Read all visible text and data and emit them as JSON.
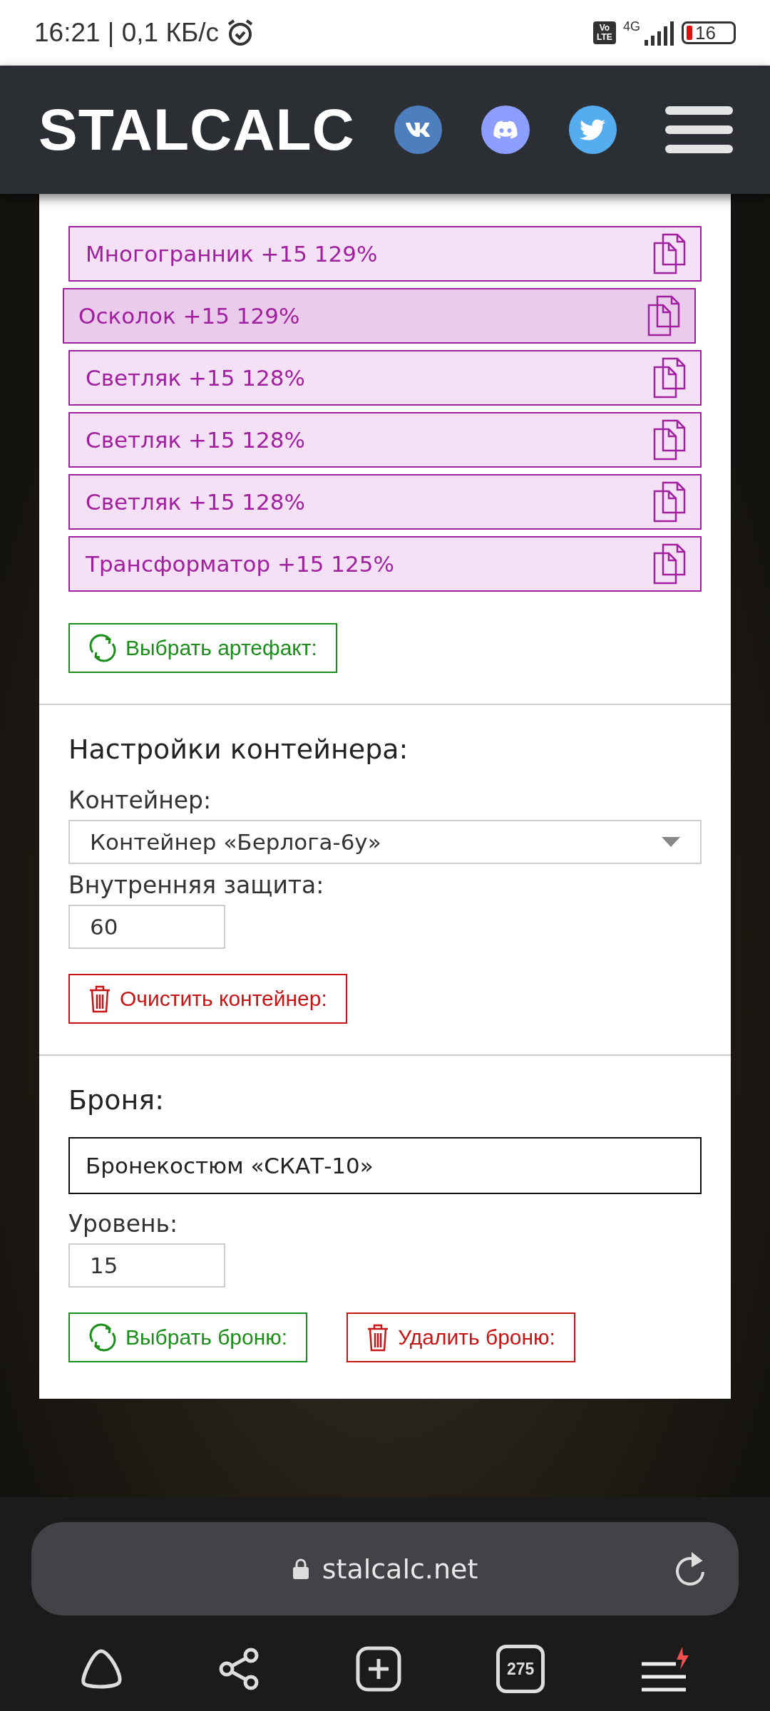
{
  "status_bar": {
    "time_speed": "16:21 | 0,1 КБ/с",
    "volte": "Vo LTE",
    "network": "4G",
    "battery": "16"
  },
  "header": {
    "logo": "STALCALC"
  },
  "artifacts": [
    {
      "label": "Многогранник +15 129%",
      "selected": false
    },
    {
      "label": "Осколок +15 129%",
      "selected": true
    },
    {
      "label": "Светляк +15 128%",
      "selected": false
    },
    {
      "label": "Светляк +15 128%",
      "selected": false
    },
    {
      "label": "Светляк +15 128%",
      "selected": false
    },
    {
      "label": "Трансформатор +15 125%",
      "selected": false
    }
  ],
  "select_artifact_button": "Выбрать артефакт:",
  "container_settings": {
    "title": "Настройки контейнера:",
    "container_label": "Контейнер:",
    "container_value": "Контейнер «Берлога-6у»",
    "protection_label": "Внутренняя защита:",
    "protection_value": "60",
    "clear_button": "Очистить контейнер:"
  },
  "armor": {
    "title": "Броня:",
    "armor_value": "Бронекостюм «СКАТ-10»",
    "level_label": "Уровень:",
    "level_value": "15",
    "select_button": "Выбрать броню:",
    "delete_button": "Удалить броню:"
  },
  "browser": {
    "url": "stalcalc.net",
    "tab_count": "275"
  }
}
